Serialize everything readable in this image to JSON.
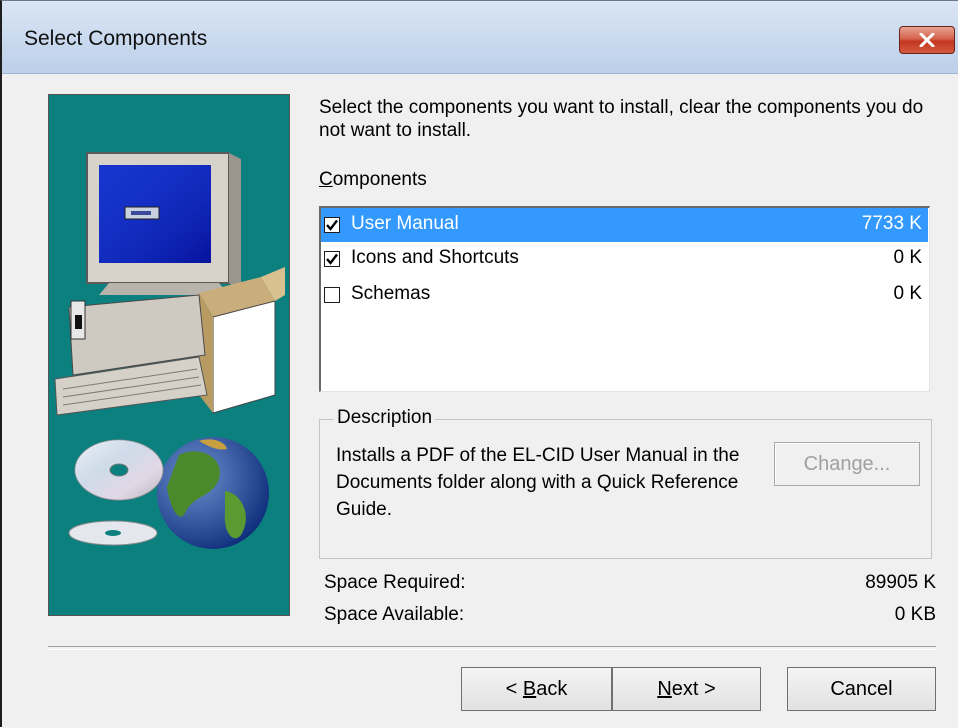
{
  "window": {
    "title": "Select Components"
  },
  "instruction": "Select the components you want to install, clear the components you do not want to install.",
  "components": {
    "label_prefix": "C",
    "label_rest": "omponents",
    "items": [
      {
        "name": "User Manual",
        "size": "7733 K",
        "checked": true,
        "selected": true
      },
      {
        "name": "Icons and Shortcuts",
        "size": "0 K",
        "checked": true,
        "selected": false
      },
      {
        "name": "Schemas",
        "size": "0 K",
        "checked": false,
        "selected": false
      }
    ]
  },
  "description": {
    "legend": "Description",
    "text": "Installs a PDF of the EL-CID User Manual in the Documents folder along with a Quick Reference Guide.",
    "change_label": "Change..."
  },
  "space": {
    "required_label": "Space Required:",
    "required_value": "89905 K",
    "available_label": "Space Available:",
    "available_value": "0 KB"
  },
  "buttons": {
    "back_prefix": "< ",
    "back_underline": "B",
    "back_rest": "ack",
    "next_underline": "N",
    "next_rest": "ext >",
    "cancel": "Cancel"
  },
  "icons": [
    "close-icon",
    "checkbox-checked",
    "computer-illustration",
    "cd-illustration",
    "globe-illustration"
  ]
}
